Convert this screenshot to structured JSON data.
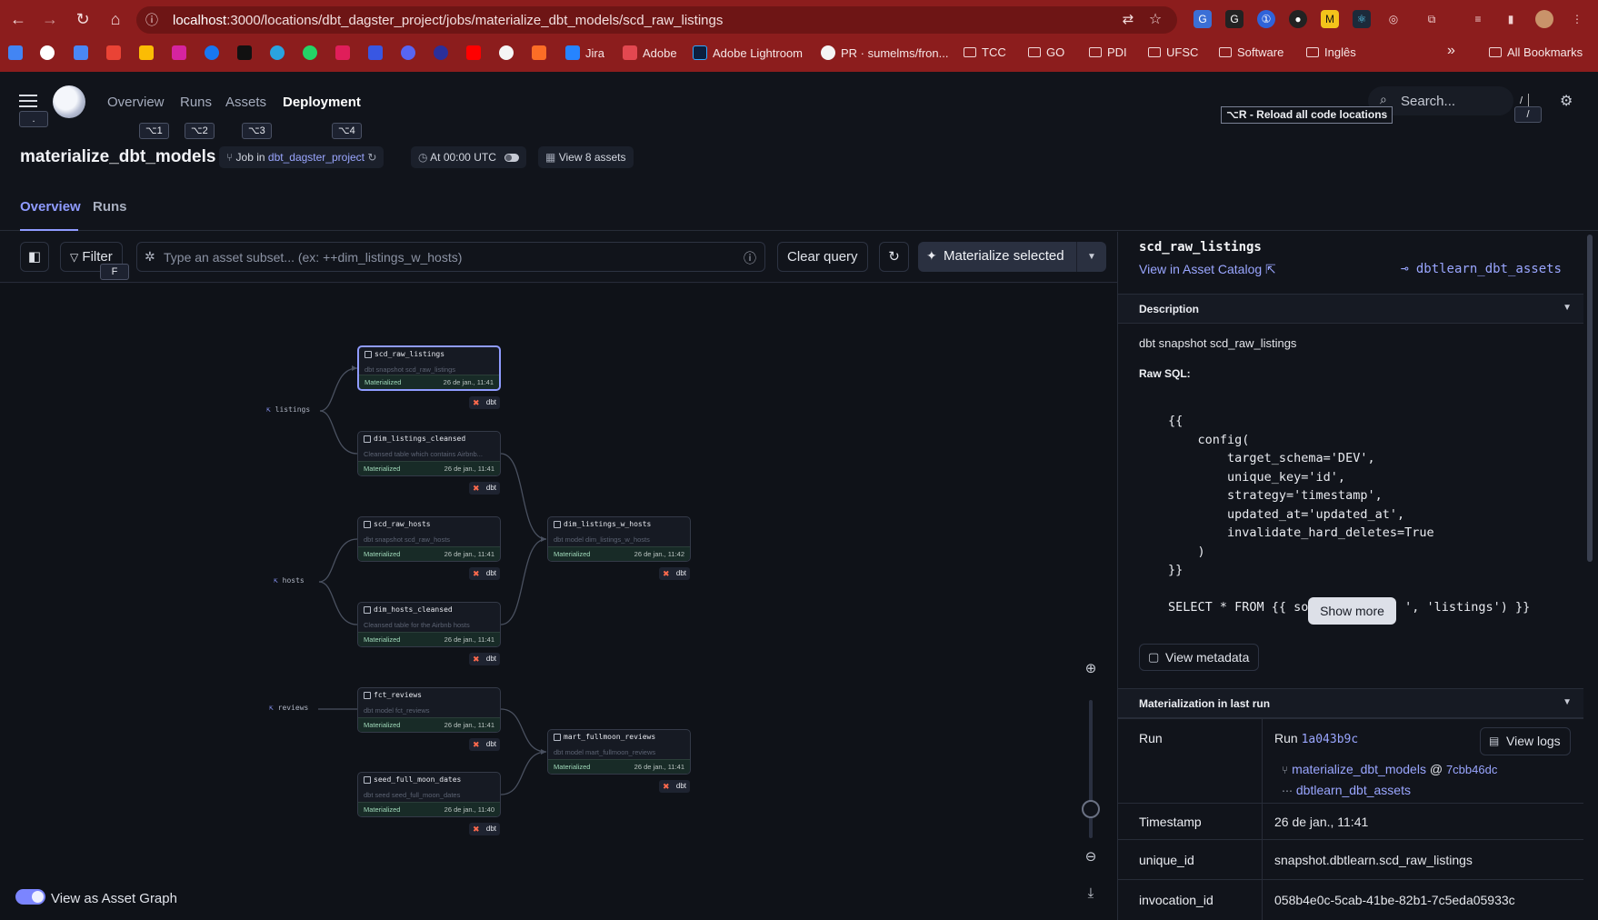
{
  "browser": {
    "url_host": "localhost",
    "url_rest": ":3000/locations/dbt_dagster_project/jobs/materialize_dbt_models/scd_raw_listings",
    "bookmarks": [
      {
        "label": "Jira",
        "color": "#2684ff"
      },
      {
        "label": "Adobe",
        "color": "#e34850"
      },
      {
        "label": "Adobe Lightroom",
        "color": "#0c1f3f"
      },
      {
        "label": "PR · sumelms/fron...",
        "color": "#ffffff"
      },
      {
        "label": "TCC",
        "folder": true
      },
      {
        "label": "GO",
        "folder": true
      },
      {
        "label": "PDI",
        "folder": true
      },
      {
        "label": "UFSC",
        "folder": true
      },
      {
        "label": "Software",
        "folder": true
      },
      {
        "label": "Inglês",
        "folder": true
      }
    ],
    "more": "»",
    "all_bookmarks": "All Bookmarks"
  },
  "app": {
    "nav": [
      {
        "label": "Overview",
        "kbd": "⌥1"
      },
      {
        "label": "Runs",
        "kbd": "⌥2"
      },
      {
        "label": "Assets",
        "kbd": "⌥3"
      },
      {
        "label": "Deployment",
        "kbd": "⌥4"
      }
    ],
    "menu_kbd": ".",
    "search_placeholder": "Search...",
    "search_kbd": "/",
    "reload_tooltip": "⌥R - Reload all code locations"
  },
  "job": {
    "title": "materialize_dbt_models",
    "job_in_prefix": "Job in",
    "location": "dbt_dagster_project",
    "schedule": "At 00:00 UTC",
    "view_assets": "View 8 assets",
    "tabs": [
      "Overview",
      "Runs"
    ]
  },
  "toolbar": {
    "filter": "Filter",
    "filter_kbd": "F",
    "query_placeholder": "Type an asset subset... (ex: ++dim_listings_w_hosts)",
    "clear_query": "Clear query",
    "materialize": "Materialize selected"
  },
  "graph": {
    "sources": [
      "listings",
      "hosts",
      "reviews"
    ],
    "status_label": "Materialized",
    "tag": "dbt",
    "nodes": [
      {
        "name": "scd_raw_listings",
        "desc": "dbt snapshot scd_raw_listings",
        "ts": "26 de jan., 11:41",
        "selected": true
      },
      {
        "name": "dim_listings_cleansed",
        "desc": "Cleansed table which contains Airbnb...",
        "ts": "26 de jan., 11:41"
      },
      {
        "name": "scd_raw_hosts",
        "desc": "dbt snapshot scd_raw_hosts",
        "ts": "26 de jan., 11:41"
      },
      {
        "name": "dim_hosts_cleansed",
        "desc": "Cleansed table for the Airbnb hosts",
        "ts": "26 de jan., 11:41"
      },
      {
        "name": "fct_reviews",
        "desc": "dbt model fct_reviews",
        "ts": "26 de jan., 11:41"
      },
      {
        "name": "seed_full_moon_dates",
        "desc": "dbt seed seed_full_moon_dates",
        "ts": "26 de jan., 11:40"
      },
      {
        "name": "dim_listings_w_hosts",
        "desc": "dbt model dim_listings_w_hosts",
        "ts": "26 de jan., 11:42"
      },
      {
        "name": "mart_fullmoon_reviews",
        "desc": "dbt model mart_fullmoon_reviews",
        "ts": "26 de jan., 11:41"
      }
    ],
    "view_as_asset_graph": "View as Asset Graph"
  },
  "panel": {
    "asset": "scd_raw_listings",
    "view_in_catalog": "View in Asset Catalog",
    "group": "dbtlearn_dbt_assets",
    "description_header": "Description",
    "description": "dbt snapshot scd_raw_listings",
    "raw_sql_label": "Raw SQL:",
    "code": "{{\n    config(\n        target_schema='DEV',\n        unique_key='id',\n        strategy='timestamp',\n        updated_at='updated_at',\n        invalidate_hard_deletes=True\n    )\n}}\n\nSELECT * FROM {{ so             ', 'listings') }}",
    "show_more": "Show more",
    "view_metadata": "View metadata",
    "mat_header": "Materialization in last run",
    "run_label": "Run",
    "run_prefix": "Run",
    "run_id": "1a043b9c",
    "view_logs": "View logs",
    "run_job": "materialize_dbt_models",
    "run_at": "@",
    "run_commit": "7cbb46dc",
    "run_group": "dbtlearn_dbt_assets",
    "timestamp_label": "Timestamp",
    "timestamp": "26 de jan., 11:41",
    "unique_id_label": "unique_id",
    "unique_id": "snapshot.dbtlearn.scd_raw_listings",
    "invocation_id_label": "invocation_id",
    "invocation_id": "058b4e0c-5cab-41be-82b1-7c5eda05933c"
  }
}
